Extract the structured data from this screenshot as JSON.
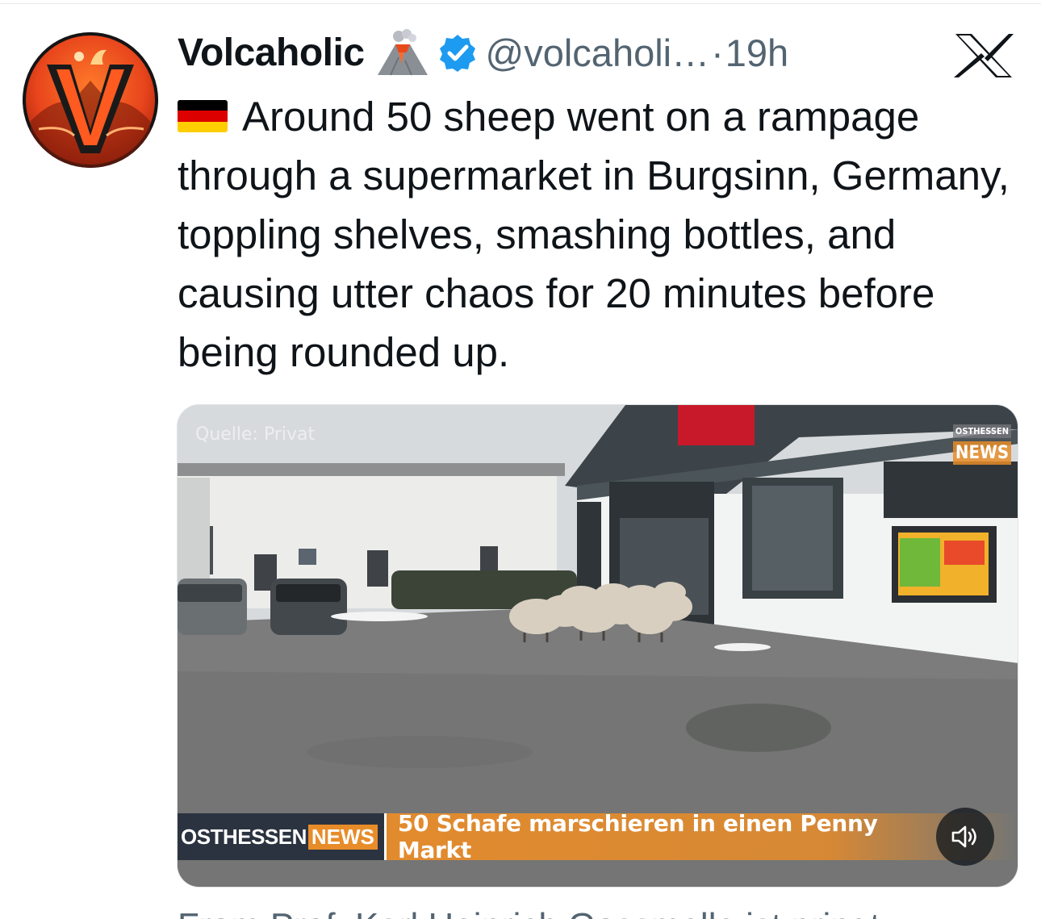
{
  "tweet": {
    "display_name": "Volcaholic",
    "handle": "@volcaholi…",
    "separator": "·",
    "time": "19h",
    "avatar_letter": "V",
    "icons": {
      "name_emoji": "volcano-emoji",
      "verified": "verified-badge-icon",
      "platform": "x-logo-icon",
      "flag": "germany-flag-icon"
    },
    "text": "Around 50 sheep went on a rampage through a supermarket in Burgsinn, Germany, toppling shelves, smashing bottles, and causing utter chaos for 20 minutes before being rounded up."
  },
  "video": {
    "source_watermark": "Quelle: Privat",
    "corner_logo_top": "OSTHESSEN",
    "corner_logo_bottom": "NEWS",
    "lower_third_brand": "OSTHESSEN",
    "lower_third_brand_accent": "NEWS",
    "lower_third_headline": "50 Schafe marschieren in einen Penny Markt",
    "mute_icon": "speaker-icon"
  },
  "next_tweet_cutoff": "From Prof. Karl Heinrich Gossmelle ist pringt",
  "colors": {
    "verified_blue": "#1d9bf0",
    "secondary_text": "#536471",
    "accent_orange": "#e88c2a",
    "brand_dark": "#2b3340"
  }
}
